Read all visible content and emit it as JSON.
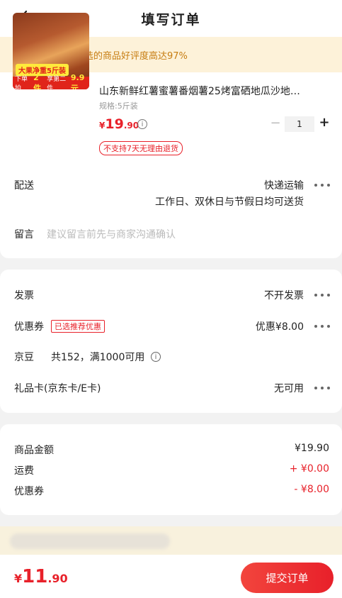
{
  "header": {
    "title": "填写订单"
  },
  "banner": {
    "text": "恭喜你，挑选的商品好评度高达97%"
  },
  "product": {
    "title": "山东新鲜红薯蜜薯番烟薯25烤富硒地瓜沙地…",
    "spec": "规格:5斤装",
    "price_currency": "¥",
    "price_int": "19",
    "price_dec": ".90",
    "quantity": "1",
    "minus": "−",
    "plus": "+",
    "no_return": "不支持7天无理由退货",
    "img_tag1": "大果净重5斤装",
    "img_tag2_a": "下单拍",
    "img_tag2_b": "2件",
    "img_tag2_c": "享第二件",
    "img_tag2_d": "9.9元"
  },
  "delivery": {
    "label": "配送",
    "method": "快递运输",
    "schedule": "工作日、双休日与节假日均可送货"
  },
  "message": {
    "label": "留言",
    "placeholder": "建议留言前先与商家沟通确认"
  },
  "invoice": {
    "label": "发票",
    "value": "不开发票"
  },
  "coupon": {
    "label": "优惠券",
    "badge": "已选推荐优惠",
    "value": "优惠¥8.00"
  },
  "jingdou": {
    "label": "京豆",
    "value": "共152，满1000可用"
  },
  "giftcard": {
    "label": "礼品卡(京东卡/E卡)",
    "value": "无可用"
  },
  "summary": {
    "goods_label": "商品金额",
    "goods_value": "¥19.90",
    "shipping_label": "运费",
    "shipping_value": "+ ¥0.00",
    "coupon_label": "优惠券",
    "coupon_value": "- ¥8.00"
  },
  "footer": {
    "currency": "¥",
    "total_int": "11",
    "total_dec": ".90",
    "submit": "提交订单"
  },
  "colors": {
    "accent": "#e8212a",
    "banner_bg": "#fdf2d9",
    "banner_text": "#c77d12"
  }
}
